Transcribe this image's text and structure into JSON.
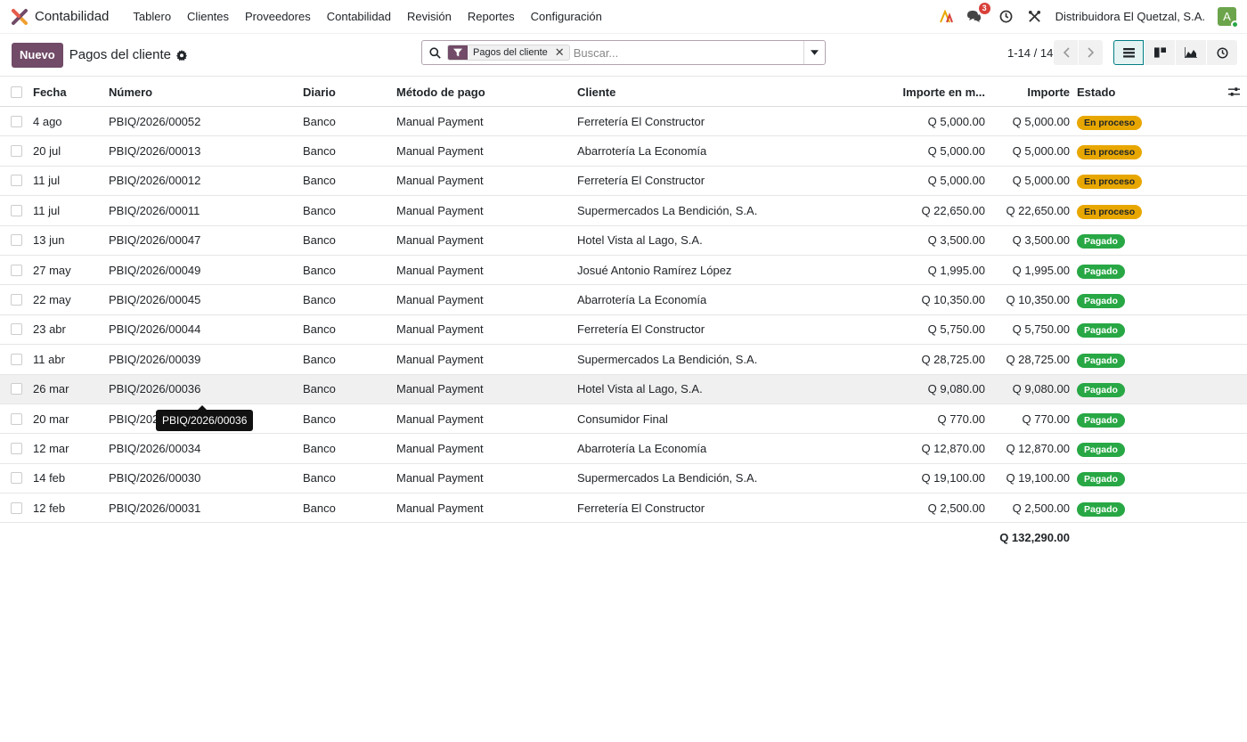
{
  "app": {
    "name": "Contabilidad"
  },
  "menu": [
    "Tablero",
    "Clientes",
    "Proveedores",
    "Contabilidad",
    "Revisión",
    "Reportes",
    "Configuración"
  ],
  "navbar": {
    "messages_count": "3",
    "company": "Distribuidora El Quetzal, S.A.",
    "avatar_letter": "A"
  },
  "control": {
    "new_label": "Nuevo",
    "title": "Pagos del cliente",
    "facet_label": "Pagos del cliente",
    "search_placeholder": "Buscar...",
    "pager": "1-14 / 14"
  },
  "columns": {
    "fecha": "Fecha",
    "numero": "Número",
    "diario": "Diario",
    "metodo": "Método de pago",
    "cliente": "Cliente",
    "importe_moneda": "Importe en m...",
    "importe": "Importe",
    "estado": "Estado"
  },
  "rows": [
    {
      "fecha": "4 ago",
      "numero": "PBIQ/2026/00052",
      "diario": "Banco",
      "metodo": "Manual Payment",
      "cliente": "Ferretería El Constructor",
      "imp_mon": "Q 5,000.00",
      "imp": "Q 5,000.00",
      "estado": "En proceso",
      "kind": "proc"
    },
    {
      "fecha": "20 jul",
      "numero": "PBIQ/2026/00013",
      "diario": "Banco",
      "metodo": "Manual Payment",
      "cliente": "Abarrotería La Economía",
      "imp_mon": "Q 5,000.00",
      "imp": "Q 5,000.00",
      "estado": "En proceso",
      "kind": "proc"
    },
    {
      "fecha": "11 jul",
      "numero": "PBIQ/2026/00012",
      "diario": "Banco",
      "metodo": "Manual Payment",
      "cliente": "Ferretería El Constructor",
      "imp_mon": "Q 5,000.00",
      "imp": "Q 5,000.00",
      "estado": "En proceso",
      "kind": "proc"
    },
    {
      "fecha": "11 jul",
      "numero": "PBIQ/2026/00011",
      "diario": "Banco",
      "metodo": "Manual Payment",
      "cliente": "Supermercados La Bendición, S.A.",
      "imp_mon": "Q 22,650.00",
      "imp": "Q 22,650.00",
      "estado": "En proceso",
      "kind": "proc"
    },
    {
      "fecha": "13 jun",
      "numero": "PBIQ/2026/00047",
      "diario": "Banco",
      "metodo": "Manual Payment",
      "cliente": "Hotel Vista al Lago, S.A.",
      "imp_mon": "Q 3,500.00",
      "imp": "Q 3,500.00",
      "estado": "Pagado",
      "kind": "paid"
    },
    {
      "fecha": "27 may",
      "numero": "PBIQ/2026/00049",
      "diario": "Banco",
      "metodo": "Manual Payment",
      "cliente": "Josué Antonio Ramírez López",
      "imp_mon": "Q 1,995.00",
      "imp": "Q 1,995.00",
      "estado": "Pagado",
      "kind": "paid"
    },
    {
      "fecha": "22 may",
      "numero": "PBIQ/2026/00045",
      "diario": "Banco",
      "metodo": "Manual Payment",
      "cliente": "Abarrotería La Economía",
      "imp_mon": "Q 10,350.00",
      "imp": "Q 10,350.00",
      "estado": "Pagado",
      "kind": "paid"
    },
    {
      "fecha": "23 abr",
      "numero": "PBIQ/2026/00044",
      "diario": "Banco",
      "metodo": "Manual Payment",
      "cliente": "Ferretería El Constructor",
      "imp_mon": "Q 5,750.00",
      "imp": "Q 5,750.00",
      "estado": "Pagado",
      "kind": "paid"
    },
    {
      "fecha": "11 abr",
      "numero": "PBIQ/2026/00039",
      "diario": "Banco",
      "metodo": "Manual Payment",
      "cliente": "Supermercados La Bendición, S.A.",
      "imp_mon": "Q 28,725.00",
      "imp": "Q 28,725.00",
      "estado": "Pagado",
      "kind": "paid"
    },
    {
      "fecha": "26 mar",
      "numero": "PBIQ/2026/00036",
      "diario": "Banco",
      "metodo": "Manual Payment",
      "cliente": "Hotel Vista al Lago, S.A.",
      "imp_mon": "Q 9,080.00",
      "imp": "Q 9,080.00",
      "estado": "Pagado",
      "kind": "paid",
      "hover": true
    },
    {
      "fecha": "20 mar",
      "numero": "PBIQ/2026/00035",
      "diario": "Banco",
      "metodo": "Manual Payment",
      "cliente": "Consumidor Final",
      "imp_mon": "Q 770.00",
      "imp": "Q 770.00",
      "estado": "Pagado",
      "kind": "paid"
    },
    {
      "fecha": "12 mar",
      "numero": "PBIQ/2026/00034",
      "diario": "Banco",
      "metodo": "Manual Payment",
      "cliente": "Abarrotería La Economía",
      "imp_mon": "Q 12,870.00",
      "imp": "Q 12,870.00",
      "estado": "Pagado",
      "kind": "paid"
    },
    {
      "fecha": "14 feb",
      "numero": "PBIQ/2026/00030",
      "diario": "Banco",
      "metodo": "Manual Payment",
      "cliente": "Supermercados La Bendición, S.A.",
      "imp_mon": "Q 19,100.00",
      "imp": "Q 19,100.00",
      "estado": "Pagado",
      "kind": "paid"
    },
    {
      "fecha": "12 feb",
      "numero": "PBIQ/2026/00031",
      "diario": "Banco",
      "metodo": "Manual Payment",
      "cliente": "Ferretería El Constructor",
      "imp_mon": "Q 2,500.00",
      "imp": "Q 2,500.00",
      "estado": "Pagado",
      "kind": "paid"
    }
  ],
  "total": "Q 132,290.00",
  "tooltip": "PBIQ/2026/00036",
  "colors": {
    "brand": "#714b67",
    "paid": "#28a745",
    "in_process": "#e8a700"
  }
}
